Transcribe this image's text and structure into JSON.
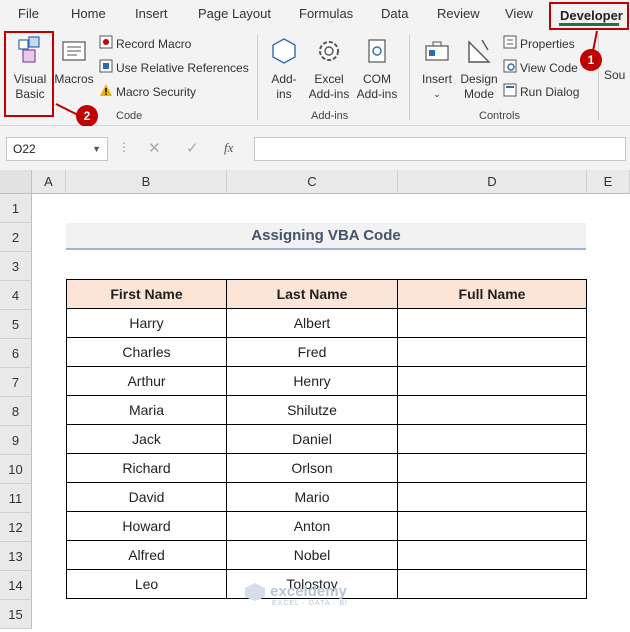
{
  "menu": {
    "tabs": [
      "File",
      "Home",
      "Insert",
      "Page Layout",
      "Formulas",
      "Data",
      "Review",
      "View"
    ],
    "developer": "Developer"
  },
  "ribbon": {
    "visual_basic": [
      "Visual",
      "Basic"
    ],
    "macros": "Macros",
    "record_macro": "Record Macro",
    "use_relative": "Use Relative References",
    "macro_security": "Macro Security",
    "group_code": "Code",
    "addins": [
      "Add-",
      "ins"
    ],
    "excel_addins": [
      "Excel",
      "Add-ins"
    ],
    "com_addins": [
      "COM",
      "Add-ins"
    ],
    "group_addins": "Add-ins",
    "insert": "Insert",
    "design_mode": [
      "Design",
      "Mode"
    ],
    "properties": "Properties",
    "view_code": "View Code",
    "run_dialog": "Run Dialog",
    "group_controls": "Controls",
    "source_partial": "Sou"
  },
  "badges": {
    "one": "1",
    "two": "2"
  },
  "formula_bar": {
    "cell_ref": "O22",
    "fx": "fx",
    "value": ""
  },
  "columns": [
    "A",
    "B",
    "C",
    "D",
    "E"
  ],
  "rows": [
    "1",
    "2",
    "3",
    "4",
    "5",
    "6",
    "7",
    "8",
    "9",
    "10",
    "11",
    "12",
    "13",
    "14",
    "15"
  ],
  "sheet": {
    "title": "Assigning VBA Code",
    "headers": [
      "First Name",
      "Last Name",
      "Full Name"
    ],
    "data": [
      [
        "Harry",
        "Albert",
        ""
      ],
      [
        "Charles",
        "Fred",
        ""
      ],
      [
        "Arthur",
        "Henry",
        ""
      ],
      [
        "Maria",
        "Shilutze",
        ""
      ],
      [
        "Jack",
        "Daniel",
        ""
      ],
      [
        "Richard",
        "Orlson",
        ""
      ],
      [
        "David",
        "Mario",
        ""
      ],
      [
        "Howard",
        "Anton",
        ""
      ],
      [
        "Alfred",
        "Nobel",
        ""
      ],
      [
        "Leo",
        "Tolostoy",
        ""
      ]
    ]
  },
  "watermark": {
    "name": "exceldemy",
    "tagline": "EXCEL · DATA · BI"
  },
  "colors": {
    "accent_red": "#c00000",
    "excel_green": "#217346",
    "header_fill": "#fce4d6",
    "title_text": "#44546a"
  }
}
